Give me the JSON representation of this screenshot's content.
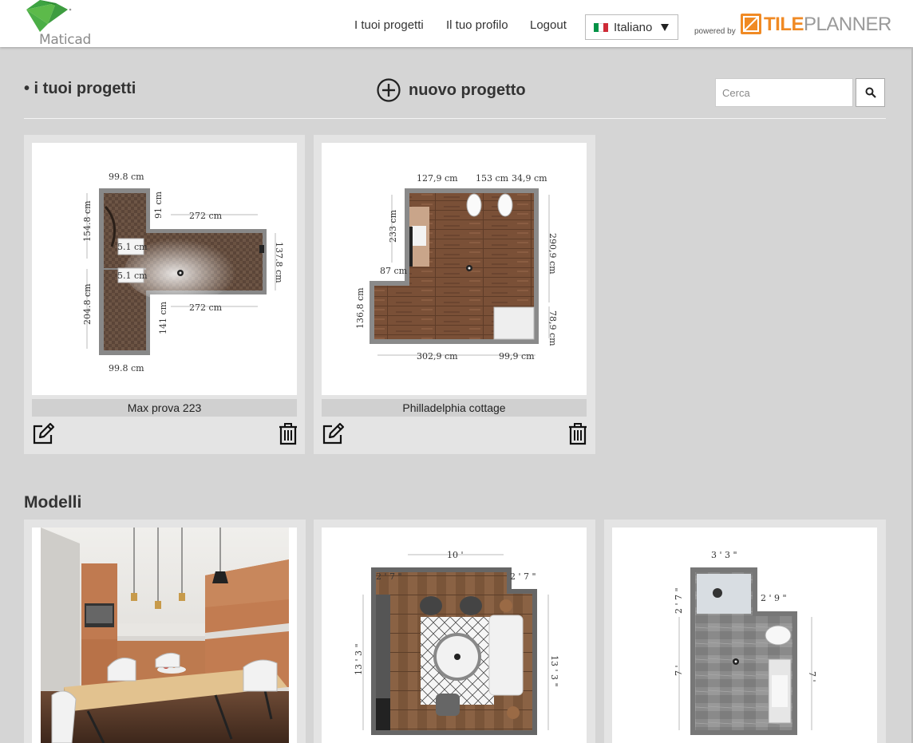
{
  "header": {
    "logo_text": "Maticad",
    "nav": [
      "I tuoi progetti",
      "Il tuo profilo",
      "Logout"
    ],
    "language": "Italiano",
    "powered_by": "powered by",
    "brand_a": "TILE",
    "brand_b": "PLANNER"
  },
  "projects": {
    "title": "• i tuoi progetti",
    "new_label": "nuovo progetto",
    "search_placeholder": "Cerca",
    "items": [
      {
        "name": "Max prova 223",
        "dims": [
          "99.8 cm",
          "91 cm",
          "272 cm",
          "154.8 cm",
          "5.1 cm",
          "5.1 cm",
          "137.8 cm",
          "204.8 cm",
          "141 cm",
          "272 cm",
          "99.8 cm"
        ]
      },
      {
        "name": "Philladelphia cottage",
        "dims": [
          "127,9 cm",
          "153 cm",
          "34,9 cm",
          "233 cm",
          "290,9 cm",
          "87 cm",
          "136,8 cm",
          "78,9 cm",
          "302,9 cm",
          "99,9 cm"
        ]
      }
    ]
  },
  "models": {
    "title": "Modelli",
    "items": [
      {
        "type": "kitchen-render"
      },
      {
        "dims": [
          "10 '",
          "2 ' 7 \"",
          "2 ' 7 \"",
          "13 ' 3 \"",
          "13 ' 3 \""
        ]
      },
      {
        "dims": [
          "3 ' 3 \"",
          "2 ' 7 \"",
          "2 ' 9 \"",
          "7 '",
          "7 '"
        ]
      }
    ]
  }
}
